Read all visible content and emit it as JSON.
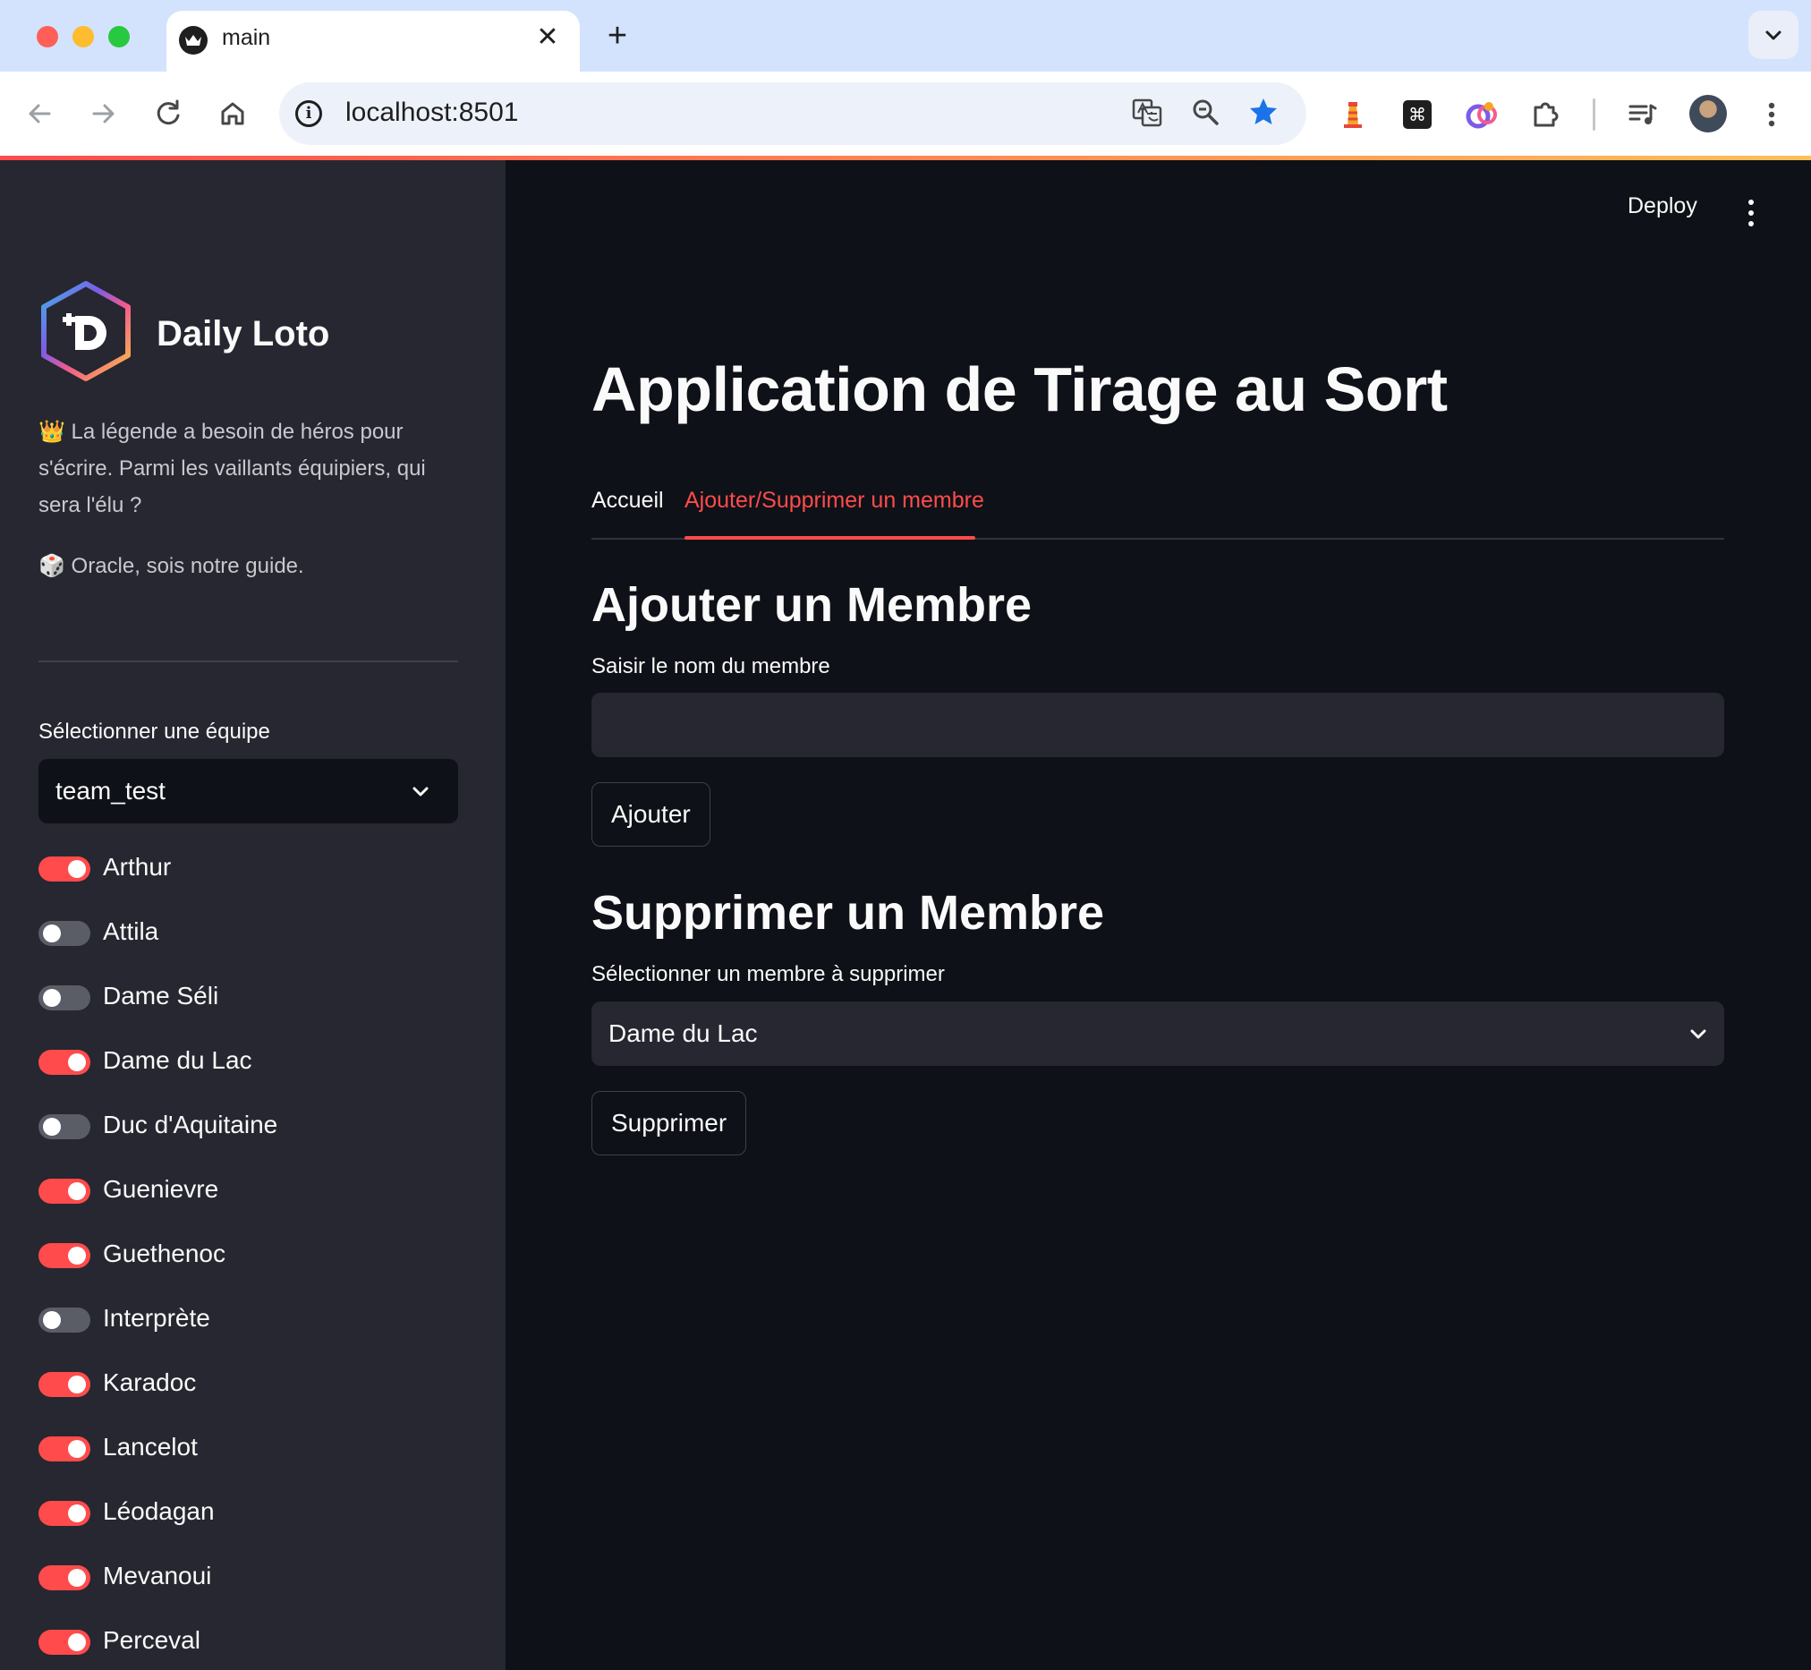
{
  "browser": {
    "tab_title": "main",
    "tab_close": "✕",
    "new_tab": "+",
    "url": "localhost:8501",
    "info_glyph": "i"
  },
  "header": {
    "deploy_label": "Deploy"
  },
  "sidebar": {
    "app_name": "Daily Loto",
    "intro_text": "👑 La légende a besoin de héros pour s'écrire. Parmi les vaillants équipiers, qui sera l'élu ?",
    "oracle_text": "🎲 Oracle, sois notre guide.",
    "team_label": "Sélectionner une équipe",
    "team_value": "team_test",
    "members": [
      {
        "name": "Arthur",
        "on": true
      },
      {
        "name": "Attila",
        "on": false
      },
      {
        "name": "Dame Séli",
        "on": false
      },
      {
        "name": "Dame du Lac",
        "on": true
      },
      {
        "name": "Duc d'Aquitaine",
        "on": false
      },
      {
        "name": "Guenievre",
        "on": true
      },
      {
        "name": "Guethenoc",
        "on": true
      },
      {
        "name": "Interprète",
        "on": false
      },
      {
        "name": "Karadoc",
        "on": true
      },
      {
        "name": "Lancelot",
        "on": true
      },
      {
        "name": "Léodagan",
        "on": true
      },
      {
        "name": "Mevanoui",
        "on": true
      },
      {
        "name": "Perceval",
        "on": true
      }
    ]
  },
  "main": {
    "title": "Application de Tirage au Sort",
    "tabs": [
      {
        "label": "Accueil",
        "active": false
      },
      {
        "label": "Ajouter/Supprimer un membre",
        "active": true
      }
    ],
    "add_heading": "Ajouter un Membre",
    "add_label": "Saisir le nom du membre",
    "add_value": "",
    "add_button": "Ajouter",
    "remove_heading": "Supprimer un Membre",
    "remove_label": "Sélectionner un membre à supprimer",
    "remove_value": "Dame du Lac",
    "remove_button": "Supprimer"
  },
  "colors": {
    "accent": "#ff4b4b",
    "sidebar_bg": "#262730",
    "main_bg": "#0e1117",
    "text": "#fafafa"
  }
}
